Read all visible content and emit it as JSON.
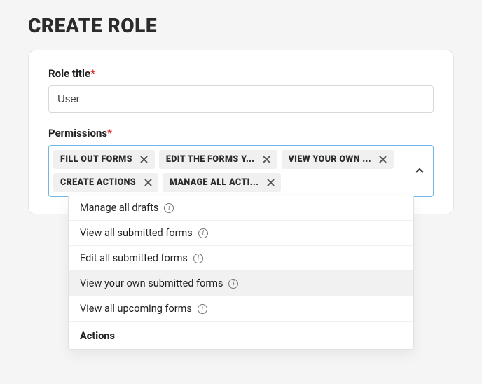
{
  "page": {
    "title": "CREATE ROLE"
  },
  "form": {
    "role_title_label": "Role title",
    "role_title_value": "User",
    "permissions_label": "Permissions",
    "required_marker": "*"
  },
  "permissions": {
    "selected": [
      {
        "label": "FILL OUT FORMS"
      },
      {
        "label": "EDIT THE FORMS Y..."
      },
      {
        "label": "VIEW YOUR OWN ..."
      },
      {
        "label": "CREATE ACTIONS"
      },
      {
        "label": "MANAGE ALL ACTI..."
      }
    ],
    "dropdown": {
      "options": [
        {
          "label": "Manage all drafts",
          "partial": true,
          "highlight": false
        },
        {
          "label": "View all submitted forms",
          "partial": false,
          "highlight": false
        },
        {
          "label": "Edit all submitted forms",
          "partial": false,
          "highlight": false
        },
        {
          "label": "View your own submitted forms",
          "partial": false,
          "highlight": true
        },
        {
          "label": "View all upcoming forms",
          "partial": false,
          "highlight": false
        }
      ],
      "group_header": "Actions"
    }
  }
}
